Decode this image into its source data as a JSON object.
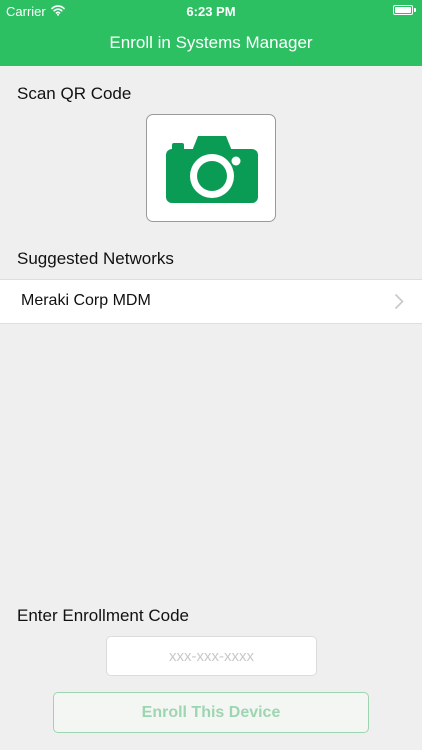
{
  "status_bar": {
    "carrier": "Carrier",
    "time": "6:23 PM"
  },
  "header": {
    "title": "Enroll in Systems Manager",
    "background": "#2cc063"
  },
  "scan": {
    "label": "Scan QR Code",
    "icon": "camera-icon",
    "icon_color": "#0a9c55"
  },
  "networks": {
    "label": "Suggested Networks",
    "items": [
      {
        "label": "Meraki Corp MDM"
      }
    ]
  },
  "enrollment": {
    "label": "Enter Enrollment Code",
    "placeholder": "xxx-xxx-xxxx",
    "value": "",
    "button_label": "Enroll This Device"
  }
}
